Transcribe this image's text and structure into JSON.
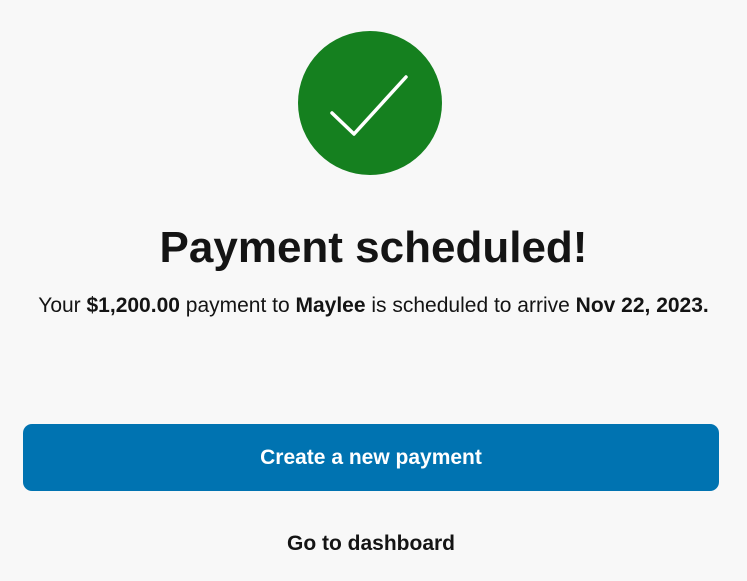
{
  "status_icon": "checkmark-icon",
  "colors": {
    "success": "#15801f",
    "primary": "#0073b1",
    "background": "#f8f8f8",
    "text": "#141414"
  },
  "title": "Payment scheduled!",
  "message": {
    "part1": "Your ",
    "amount": "$1,200.00",
    "part2": " payment to ",
    "recipient": "Maylee",
    "part3": " is scheduled to arrive ",
    "date": "Nov 22, 2023."
  },
  "actions": {
    "create_label": "Create a new payment",
    "dashboard_label": "Go to dashboard"
  }
}
